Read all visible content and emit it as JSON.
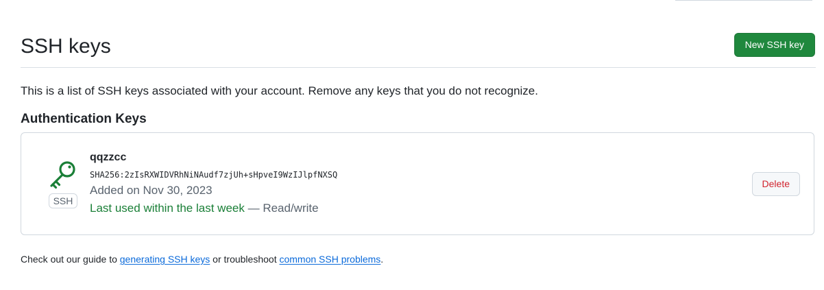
{
  "header": {
    "title": "SSH keys",
    "new_key_button": "New SSH key"
  },
  "description": "This is a list of SSH keys associated with your account. Remove any keys that you do not recognize.",
  "authentication_keys": {
    "section_title": "Authentication Keys",
    "keys": [
      {
        "icon": "key-icon",
        "type_label": "SSH",
        "name": "qqzzcc",
        "fingerprint": "SHA256:2zIsRXWIDVRhNiNAudf7zjUh+sHpveI9WzIJlpfNXSQ",
        "added": "Added on Nov 30, 2023",
        "last_used": "Last used within the last week",
        "separator": " — ",
        "access": "Read/write",
        "delete_button": "Delete"
      }
    ]
  },
  "footer": {
    "prefix": "Check out our guide to ",
    "link_generating": "generating SSH keys",
    "middle": " or troubleshoot ",
    "link_problems": "common SSH problems",
    "suffix": "."
  },
  "colors": {
    "primary_button": "#1f883d",
    "last_used_green": "#1a7f37",
    "danger_red": "#d1242f",
    "link_blue": "#0969da"
  }
}
